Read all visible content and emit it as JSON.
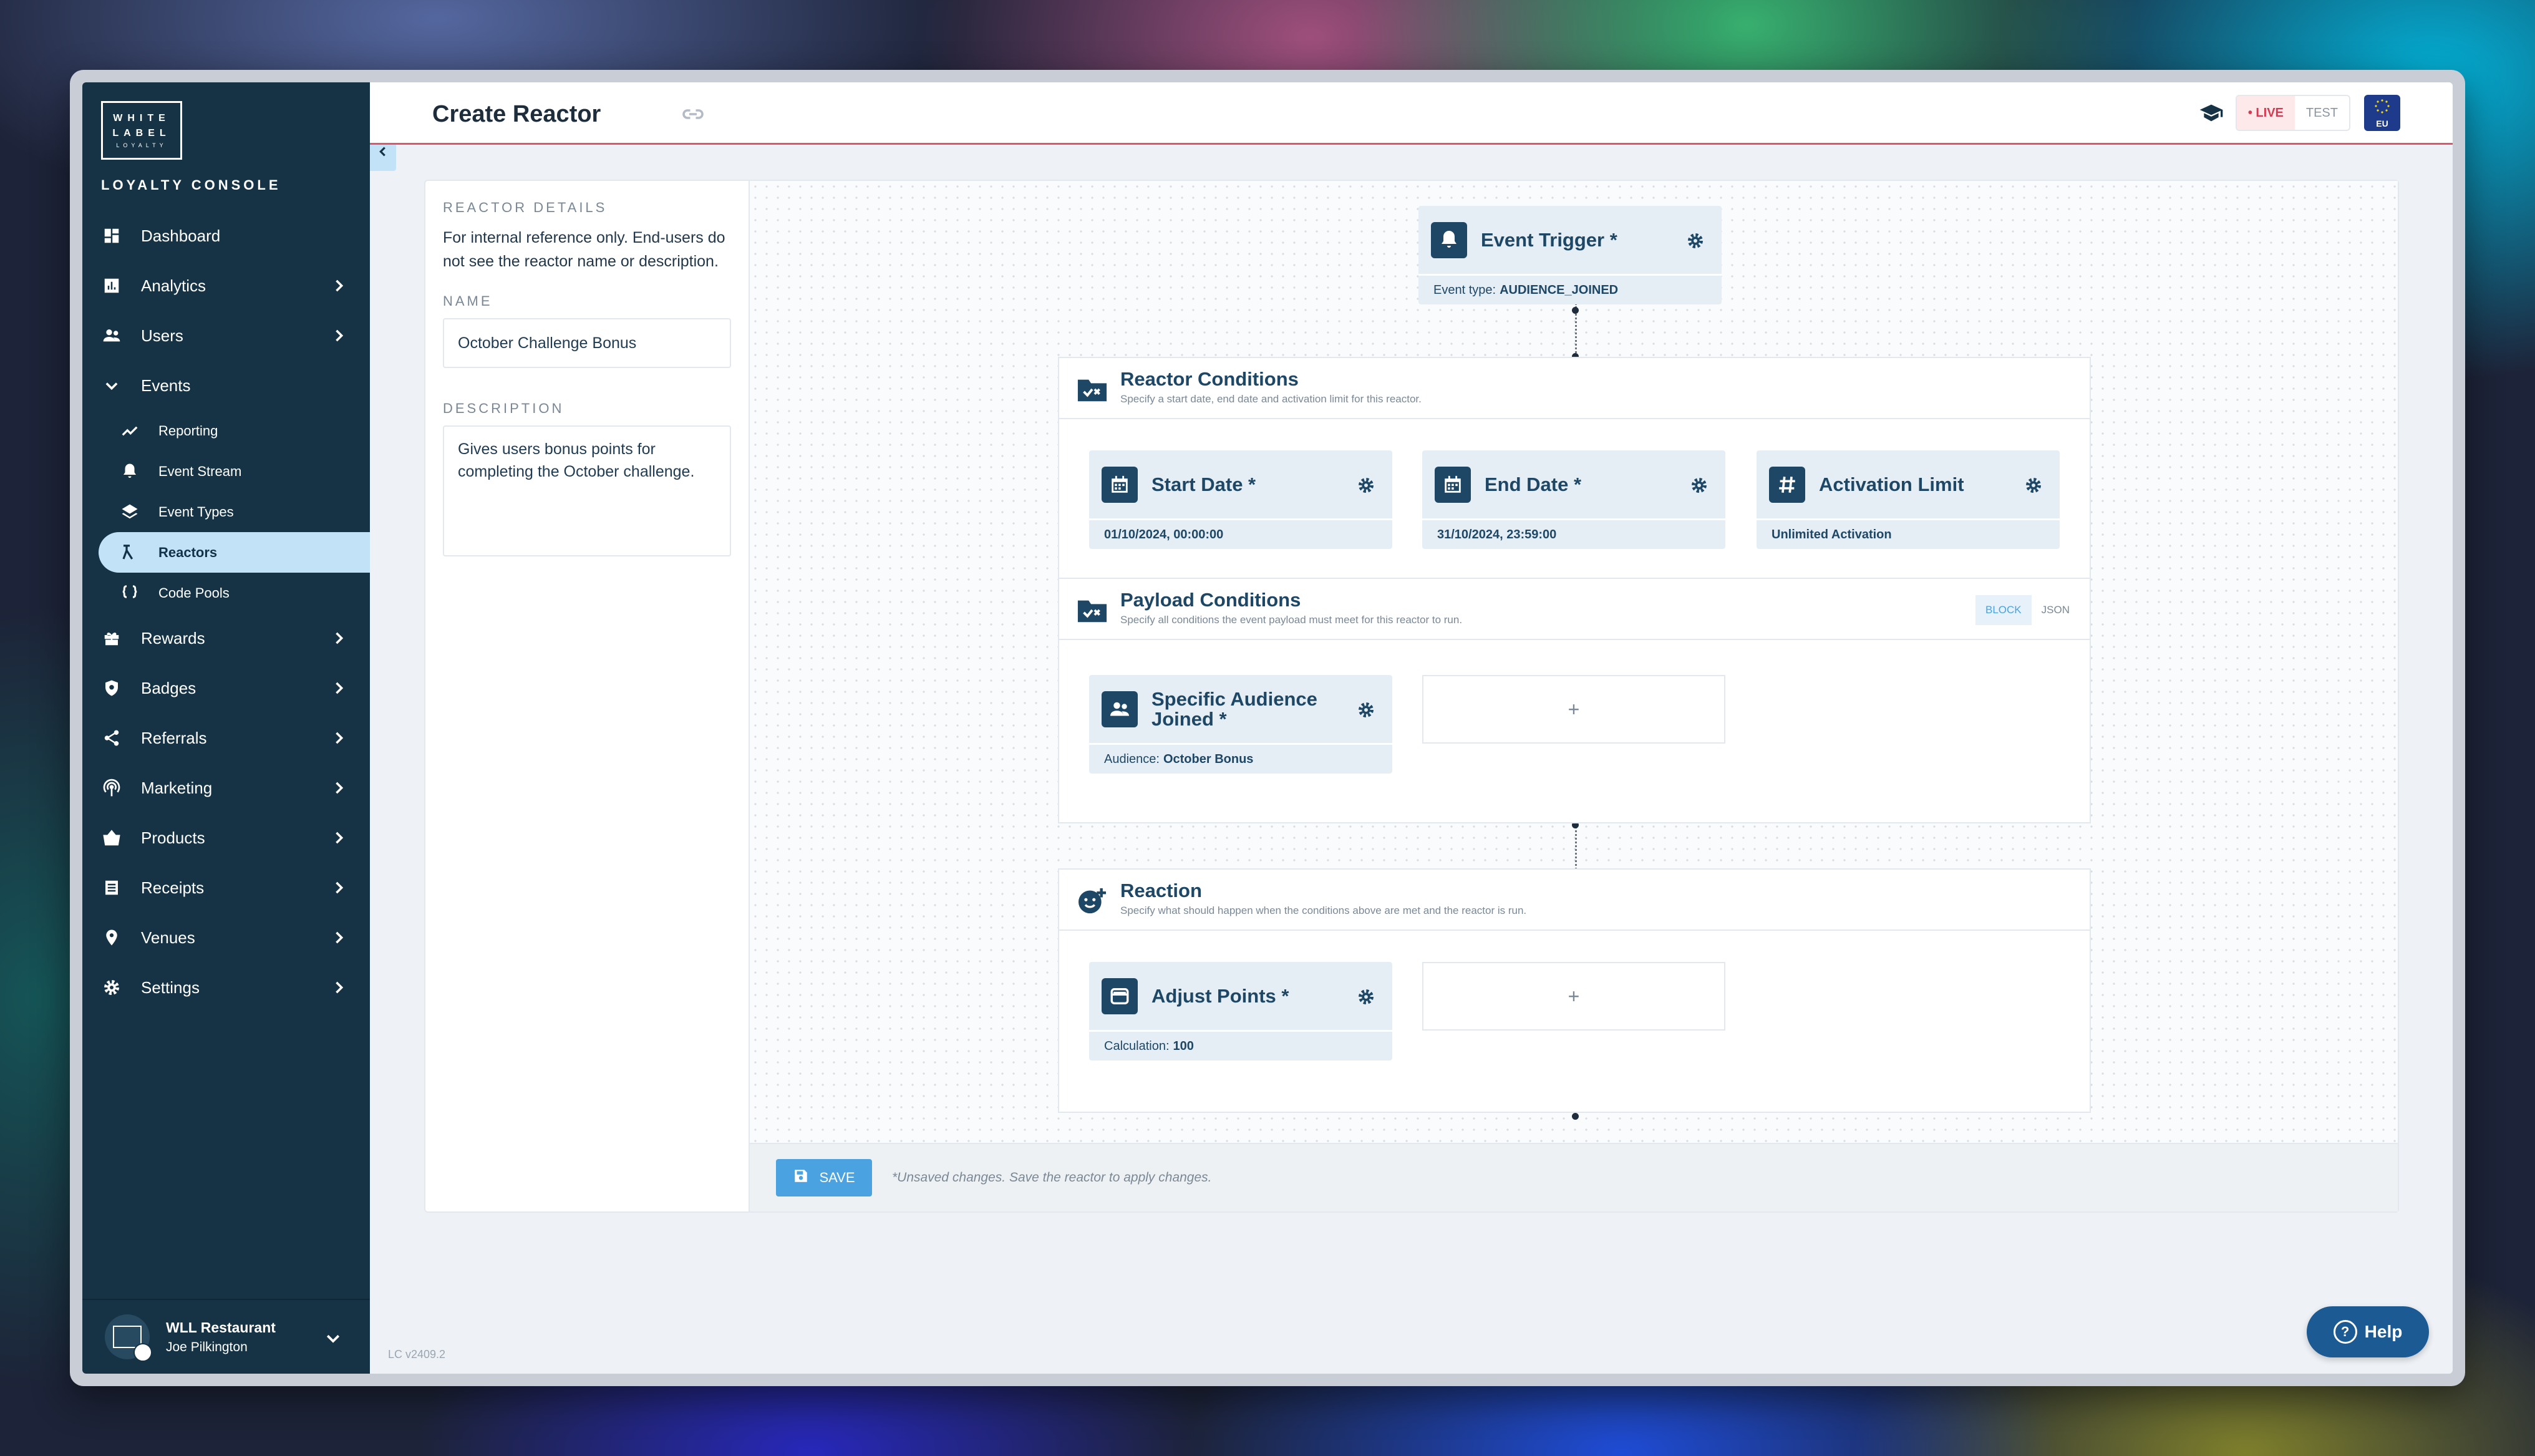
{
  "sidebar": {
    "logo_lines": [
      "WHITE",
      "LABEL",
      "LOYALTY"
    ],
    "console_title": "LOYALTY CONSOLE",
    "items": [
      {
        "label": "Dashboard"
      },
      {
        "label": "Analytics"
      },
      {
        "label": "Users"
      },
      {
        "label": "Events"
      },
      {
        "label": "Rewards"
      },
      {
        "label": "Badges"
      },
      {
        "label": "Referrals"
      },
      {
        "label": "Marketing"
      },
      {
        "label": "Products"
      },
      {
        "label": "Receipts"
      },
      {
        "label": "Venues"
      },
      {
        "label": "Settings"
      }
    ],
    "event_sub_items": [
      {
        "label": "Reporting"
      },
      {
        "label": "Event Stream"
      },
      {
        "label": "Event Types"
      },
      {
        "label": "Reactors"
      },
      {
        "label": "Code Pools"
      }
    ],
    "user": {
      "org": "WLL Restaurant",
      "name": "Joe Pilkington"
    }
  },
  "header": {
    "title": "Create Reactor",
    "env_live": "LIVE",
    "env_test": "TEST",
    "region": "EU"
  },
  "details": {
    "section_label": "REACTOR DETAILS",
    "help_text": "For internal reference only. End-users do not see the reactor name or description.",
    "name_label": "NAME",
    "name_value": "October Challenge Bonus",
    "description_label": "DESCRIPTION",
    "description_value": "Gives users bonus points for completing the October challenge."
  },
  "trigger": {
    "title": "Event Trigger *",
    "caption": "Event type:",
    "value": "AUDIENCE_JOINED"
  },
  "reactor_conditions": {
    "title": "Reactor Conditions",
    "subtitle": "Specify a start date, end date and activation limit for this reactor.",
    "blocks": [
      {
        "title": "Start Date *",
        "value": "01/10/2024, 00:00:00"
      },
      {
        "title": "End Date *",
        "value": "31/10/2024, 23:59:00"
      },
      {
        "title": "Activation Limit",
        "value": "Unlimited Activation"
      }
    ]
  },
  "payload_conditions": {
    "title": "Payload Conditions",
    "subtitle": "Specify all conditions the event payload must meet for this reactor to run.",
    "toggle_block": "BLOCK",
    "toggle_json": "JSON",
    "block": {
      "title": "Specific Audience Joined *",
      "caption": "Audience:",
      "value": "October Bonus"
    },
    "add_label": "+"
  },
  "reaction": {
    "title": "Reaction",
    "subtitle": "Specify what should happen when the conditions above are met and the reactor is run.",
    "block": {
      "title": "Adjust Points *",
      "caption": "Calculation:",
      "value": "100"
    },
    "add_label": "+"
  },
  "footer": {
    "save_label": "SAVE",
    "unsaved_note": "*Unsaved changes. Save the reactor to apply changes."
  },
  "version": "LC v2409.2",
  "help_label": "Help",
  "colors": {
    "sidebar": "#163346",
    "accent": "#4aa3e0",
    "live": "#d63a52",
    "block": "#1e4766"
  }
}
